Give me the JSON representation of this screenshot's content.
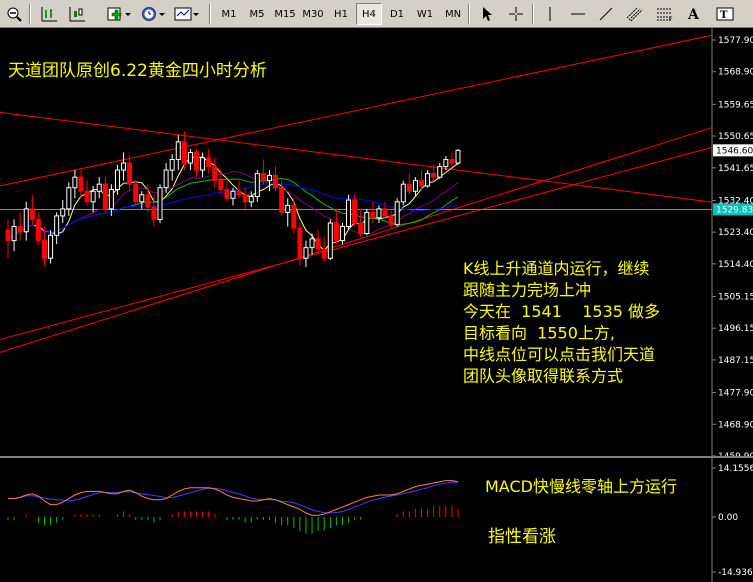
{
  "toolbar": {
    "timeframes": [
      "M1",
      "M5",
      "M15",
      "M30",
      "H1",
      "H4",
      "D1",
      "W1",
      "MN"
    ],
    "active_timeframe": "H4"
  },
  "chart": {
    "title": "天道团队原创6.22黄金四小时分析",
    "price_axis": [
      "1577.90",
      "1568.90",
      "1559.65",
      "1550.65",
      "1541.65",
      "1532.40",
      "1523.40",
      "1514.40",
      "1505.15",
      "1496.15",
      "1487.15",
      "1477.90",
      "1468.90",
      "1459.90"
    ],
    "current_price": "1546.60",
    "hline_price": "1529.83",
    "annotation_lines": [
      "K线上升通道内运行，继续",
      "跟随主力完场上冲",
      "今天在  1541    1535 做多",
      "目标看向  1550上方,",
      "中线点位可以点击我们天道",
      "团队头像取得联系方式"
    ]
  },
  "macd": {
    "note": "MACD快慢线零轴上方运行",
    "note2": "指性看涨",
    "axis": [
      "14.1556",
      "0.00",
      "-14.9365"
    ]
  },
  "colors": {
    "annotation": "#ffff00",
    "channel": "#ff0000",
    "hline": "#00c0c0",
    "bull": "#ffffff",
    "bear": "#ff0000",
    "ma_fast": "#ffff80",
    "ma_mid": "#00c000",
    "ma_slow": "#0000ff",
    "ma_purple": "#800080"
  },
  "chart_data": {
    "type": "candlestick",
    "ohlc": [
      [
        1524.0,
        1527.0,
        1516.0,
        1521.0
      ],
      [
        1521.0,
        1527.0,
        1518.0,
        1525.0
      ],
      [
        1525.0,
        1529.0,
        1521.0,
        1523.5
      ],
      [
        1523.5,
        1532.0,
        1521.0,
        1530.0
      ],
      [
        1530.0,
        1534.0,
        1525.5,
        1527.0
      ],
      [
        1527.0,
        1529.0,
        1520.0,
        1521.0
      ],
      [
        1521.0,
        1525.0,
        1514.0,
        1516.0
      ],
      [
        1516.0,
        1524.0,
        1514.5,
        1522.5
      ],
      [
        1522.5,
        1529.0,
        1520.0,
        1528.0
      ],
      [
        1528.0,
        1532.5,
        1526.0,
        1530.0
      ],
      [
        1530.0,
        1537.5,
        1528.0,
        1536.0
      ],
      [
        1536.0,
        1541.0,
        1533.0,
        1539.0
      ],
      [
        1539.0,
        1541.0,
        1533.0,
        1535.0
      ],
      [
        1535.0,
        1538.0,
        1531.0,
        1532.0
      ],
      [
        1532.0,
        1536.5,
        1529.0,
        1535.0
      ],
      [
        1535.0,
        1539.0,
        1533.0,
        1537.0
      ],
      [
        1537.0,
        1539.0,
        1529.0,
        1530.0
      ],
      [
        1530.0,
        1537.0,
        1528.0,
        1535.5
      ],
      [
        1535.5,
        1542.5,
        1534.0,
        1541.0
      ],
      [
        1541.0,
        1546.0,
        1538.0,
        1543.0
      ],
      [
        1543.0,
        1545.0,
        1535.0,
        1537.0
      ],
      [
        1537.0,
        1538.0,
        1531.0,
        1532.0
      ],
      [
        1532.0,
        1535.0,
        1530.0,
        1534.0
      ],
      [
        1534.0,
        1537.0,
        1529.0,
        1530.5
      ],
      [
        1530.5,
        1534.0,
        1525.0,
        1527.0
      ],
      [
        1527.0,
        1537.0,
        1526.0,
        1536.0
      ],
      [
        1536.0,
        1543.0,
        1534.5,
        1541.0
      ],
      [
        1541.0,
        1545.5,
        1538.0,
        1544.0
      ],
      [
        1544.0,
        1551.0,
        1541.0,
        1549.0
      ],
      [
        1549.0,
        1552.0,
        1541.0,
        1543.0
      ],
      [
        1543.0,
        1547.0,
        1541.0,
        1546.0
      ],
      [
        1546.0,
        1547.0,
        1539.0,
        1541.0
      ],
      [
        1541.0,
        1546.0,
        1539.0,
        1544.5
      ],
      [
        1544.5,
        1547.0,
        1540.0,
        1542.0
      ],
      [
        1542.0,
        1544.5,
        1536.0,
        1538.0
      ],
      [
        1538.0,
        1541.0,
        1534.0,
        1535.5
      ],
      [
        1535.5,
        1538.0,
        1532.0,
        1533.0
      ],
      [
        1533.0,
        1536.0,
        1531.0,
        1535.0
      ],
      [
        1535.0,
        1538.0,
        1533.0,
        1534.0
      ],
      [
        1534.0,
        1536.0,
        1530.0,
        1532.0
      ],
      [
        1532.0,
        1535.0,
        1530.5,
        1533.5
      ],
      [
        1533.5,
        1541.0,
        1532.0,
        1540.0
      ],
      [
        1540.0,
        1544.0,
        1537.0,
        1538.0
      ],
      [
        1538.0,
        1541.0,
        1535.0,
        1539.5
      ],
      [
        1539.5,
        1542.0,
        1535.0,
        1536.0
      ],
      [
        1536.0,
        1538.0,
        1528.0,
        1529.0
      ],
      [
        1529.0,
        1533.0,
        1525.0,
        1531.0
      ],
      [
        1531.0,
        1533.0,
        1523.0,
        1524.5
      ],
      [
        1524.5,
        1526.0,
        1514.0,
        1516.0
      ],
      [
        1516.0,
        1521.0,
        1513.5,
        1519.0
      ],
      [
        1519.0,
        1523.0,
        1517.0,
        1521.5
      ],
      [
        1521.5,
        1524.0,
        1517.5,
        1518.5
      ],
      [
        1518.5,
        1522.0,
        1515.0,
        1516.0
      ],
      [
        1516.0,
        1527.0,
        1515.5,
        1526.0
      ],
      [
        1526.0,
        1530.0,
        1520.0,
        1521.0
      ],
      [
        1521.0,
        1526.0,
        1520.0,
        1525.0
      ],
      [
        1525.0,
        1534.0,
        1524.0,
        1532.5
      ],
      [
        1532.5,
        1534.0,
        1525.0,
        1526.0
      ],
      [
        1526.0,
        1530.0,
        1522.0,
        1523.0
      ],
      [
        1523.0,
        1530.0,
        1522.5,
        1529.0
      ],
      [
        1529.0,
        1532.0,
        1526.0,
        1527.5
      ],
      [
        1527.5,
        1531.0,
        1526.0,
        1530.0
      ],
      [
        1530.0,
        1532.0,
        1527.0,
        1528.0
      ],
      [
        1528.0,
        1530.0,
        1524.5,
        1525.5
      ],
      [
        1525.5,
        1533.0,
        1525.0,
        1532.0
      ],
      [
        1532.0,
        1538.0,
        1531.0,
        1537.0
      ],
      [
        1537.0,
        1540.0,
        1534.0,
        1535.0
      ],
      [
        1535.0,
        1539.0,
        1533.5,
        1538.0
      ],
      [
        1538.0,
        1541.0,
        1535.0,
        1536.5
      ],
      [
        1536.5,
        1541.0,
        1536.0,
        1540.0
      ],
      [
        1540.0,
        1542.5,
        1538.0,
        1539.0
      ],
      [
        1539.0,
        1543.0,
        1538.5,
        1542.0
      ],
      [
        1542.0,
        1545.0,
        1541.0,
        1544.0
      ],
      [
        1544.0,
        1546.0,
        1542.0,
        1543.0
      ],
      [
        1543.0,
        1547.0,
        1542.5,
        1546.6
      ]
    ],
    "macd_hist": [
      -1,
      -1,
      0,
      1,
      0,
      -2,
      -3,
      -3,
      -2,
      -1,
      0,
      1,
      1,
      1,
      1,
      1,
      0,
      0,
      1,
      2,
      1,
      -1,
      -1,
      -1,
      -2,
      -1,
      0,
      1,
      2,
      2,
      2,
      2,
      2,
      2,
      1,
      0,
      -1,
      -1,
      -1,
      -2,
      -2,
      -1,
      -1,
      -1,
      -2,
      -3,
      -3,
      -4,
      -5,
      -6,
      -6,
      -5,
      -5,
      -4,
      -3,
      -3,
      -2,
      -1,
      -1,
      0,
      0,
      0,
      0,
      0,
      1,
      2,
      2,
      3,
      3,
      3,
      4,
      4,
      4,
      4,
      3
    ],
    "ylim": [
      1459.9,
      1577.9
    ]
  }
}
